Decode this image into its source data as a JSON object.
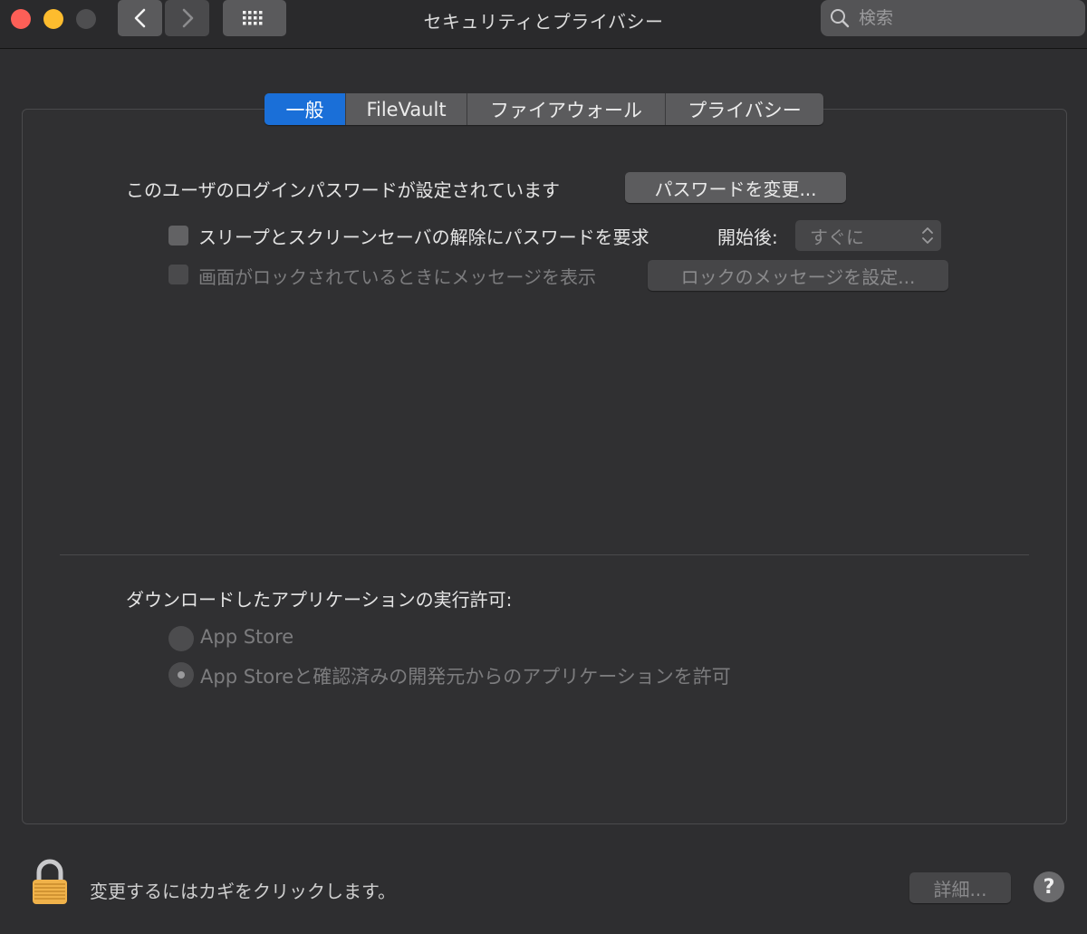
{
  "window": {
    "title": "セキュリティとプライバシー"
  },
  "search": {
    "placeholder": "検索"
  },
  "tabs": [
    {
      "label": "一般",
      "active": true
    },
    {
      "label": "FileVault",
      "active": false
    },
    {
      "label": "ファイアウォール",
      "active": false
    },
    {
      "label": "プライバシー",
      "active": false
    }
  ],
  "general": {
    "password_status": "このユーザのログインパスワードが設定されています",
    "change_password_button": "パスワードを変更...",
    "require_password_label": "スリープとスクリーンセーバの解除にパスワードを要求",
    "require_password_checked": false,
    "after_label": "開始後:",
    "after_value": "すぐに",
    "show_message_label": "画面がロックされているときにメッセージを表示",
    "show_message_checked": false,
    "set_lock_message_button": "ロックのメッセージを設定...",
    "allow_apps_heading": "ダウンロードしたアプリケーションの実行許可:",
    "radio_options": [
      {
        "label": "App Store",
        "selected": false
      },
      {
        "label": "App Storeと確認済みの開発元からのアプリケーションを許可",
        "selected": true
      }
    ]
  },
  "footer": {
    "lock_message": "変更するにはカギをクリックします。",
    "advanced_button": "詳細...",
    "help_label": "?"
  },
  "colors": {
    "accent": "#1a6fd8",
    "close": "#fc5f57",
    "minimize": "#fdbc2e",
    "zoom": "#4e4e50",
    "lock_gold": "#f0b24a"
  }
}
